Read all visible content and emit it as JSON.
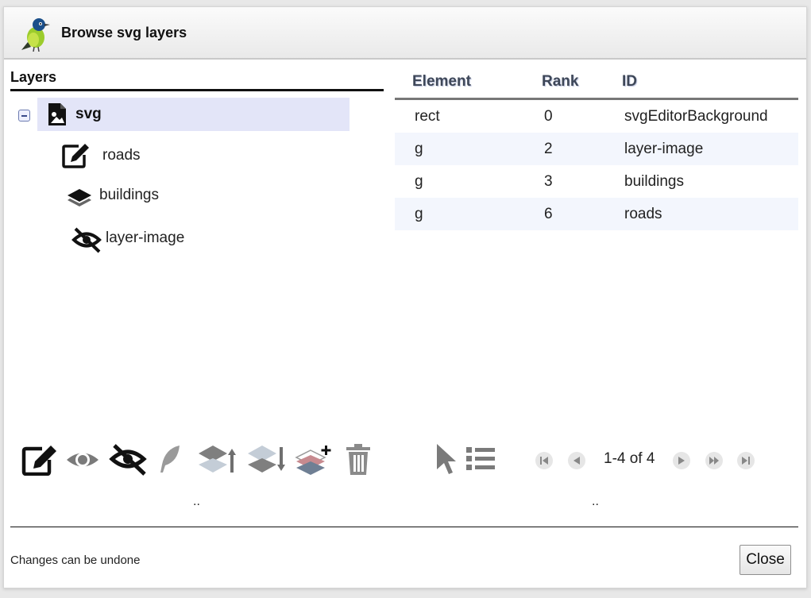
{
  "dialog": {
    "title": "Browse svg layers",
    "logo_icon": "bird-logo-icon"
  },
  "layers_panel": {
    "heading": "Layers",
    "root": {
      "label": "svg",
      "icon": "svg-file-icon",
      "expanded": true
    },
    "children": [
      {
        "label": "roads",
        "icon": "edit-icon"
      },
      {
        "label": "buildings",
        "icon": "layers-icon"
      },
      {
        "label": "layer-image",
        "icon": "eye-slash-icon"
      }
    ]
  },
  "elements_table": {
    "columns": [
      "Element",
      "Rank",
      "ID"
    ],
    "rows": [
      {
        "element": "rect",
        "rank": "0",
        "id": "svgEditorBackground"
      },
      {
        "element": "g",
        "rank": "2",
        "id": "layer-image"
      },
      {
        "element": "g",
        "rank": "3",
        "id": "buildings"
      },
      {
        "element": "g",
        "rank": "6",
        "id": "roads"
      }
    ]
  },
  "layer_toolbar": {
    "tools": [
      "edit-icon",
      "eye-icon",
      "eye-slash-icon",
      "feather-icon",
      "layer-up-icon",
      "layer-down-icon",
      "layer-add-icon",
      "trash-icon"
    ],
    "footer": ".."
  },
  "table_toolbar": {
    "tools": [
      "pointer-icon",
      "list-icon"
    ],
    "pager": {
      "text": "1-4 of 4",
      "buttons": [
        "first-page-icon",
        "prev-page-icon",
        "next-page-icon",
        "last-page-icon"
      ]
    },
    "footer": ".."
  },
  "status": {
    "text": "Changes can be undone"
  },
  "close_label": "Close",
  "colors": {
    "selected_row": "#e3e5f8",
    "alt_row": "#f3f6fd",
    "header_text": "#3e4758"
  }
}
